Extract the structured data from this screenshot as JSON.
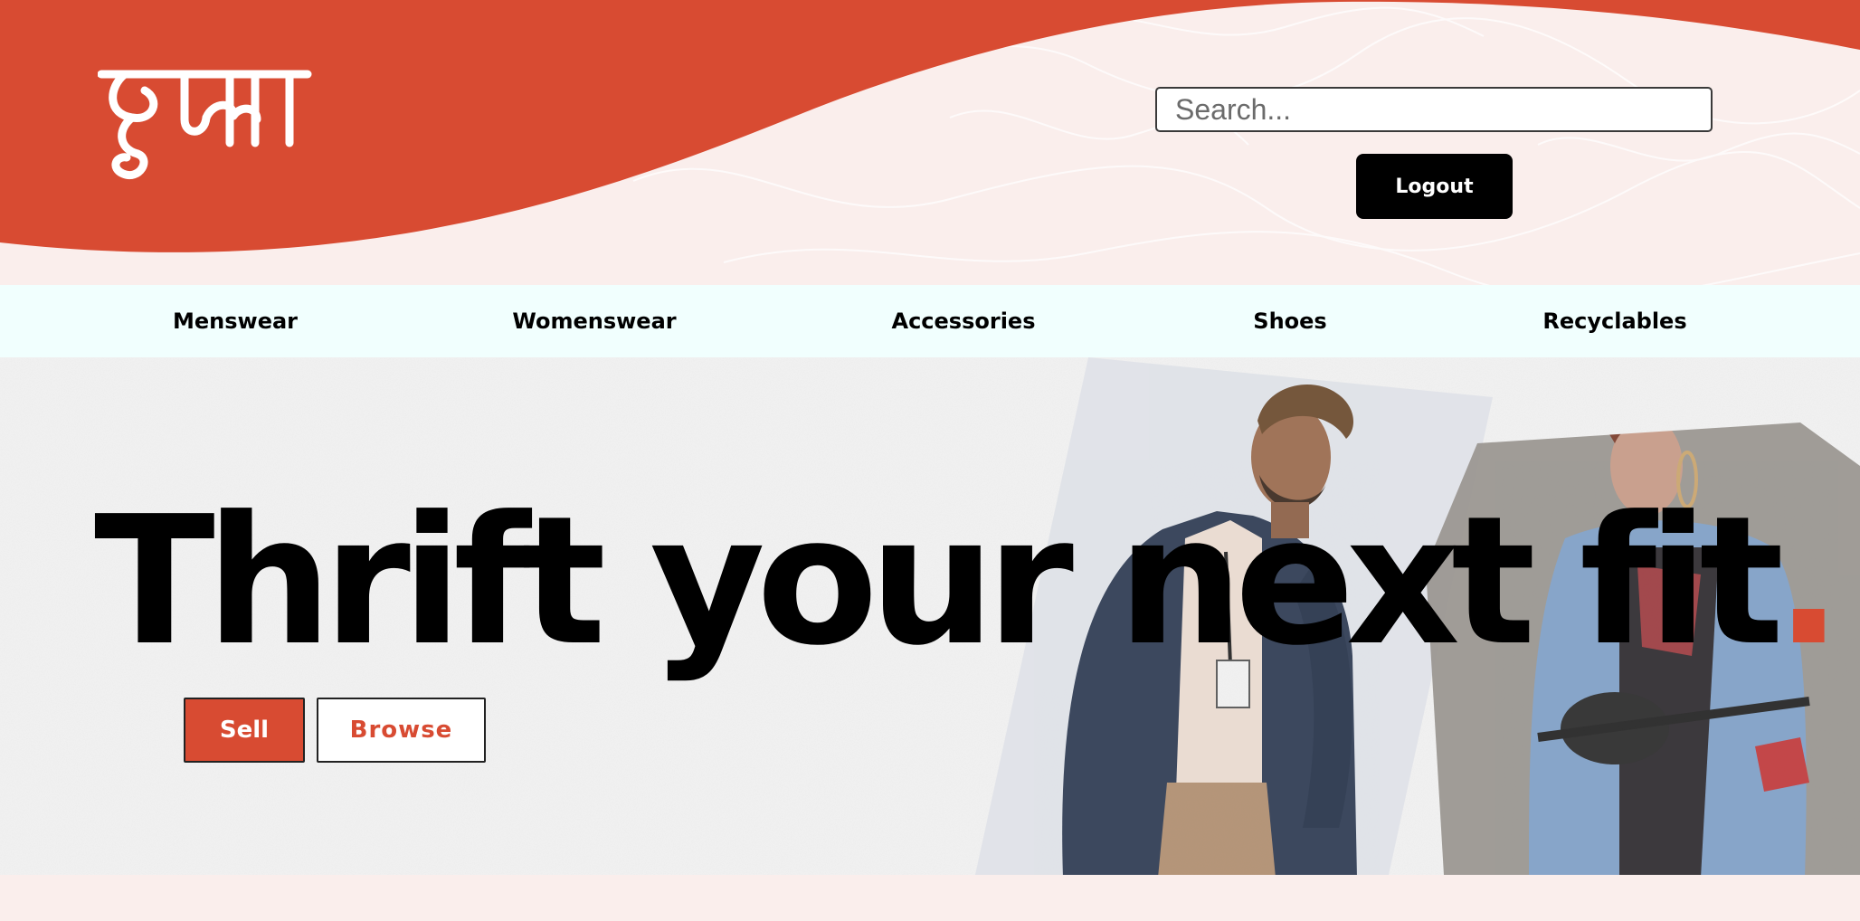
{
  "brand": {
    "logo_text": "लुगा",
    "accent_color": "#d84b32",
    "background_color": "#faeeec",
    "nav_background": "#f1fffe"
  },
  "header": {
    "search": {
      "placeholder": "Search...",
      "value": ""
    },
    "logout_label": "Logout"
  },
  "nav": {
    "items": [
      {
        "label": "Menswear"
      },
      {
        "label": "Womenswear"
      },
      {
        "label": "Accessories"
      },
      {
        "label": "Shoes"
      },
      {
        "label": "Recyclables"
      }
    ]
  },
  "hero": {
    "headline": "Thrift your next fit",
    "headline_dot": ".",
    "sell_label": "Sell",
    "browse_label": "Browse"
  }
}
